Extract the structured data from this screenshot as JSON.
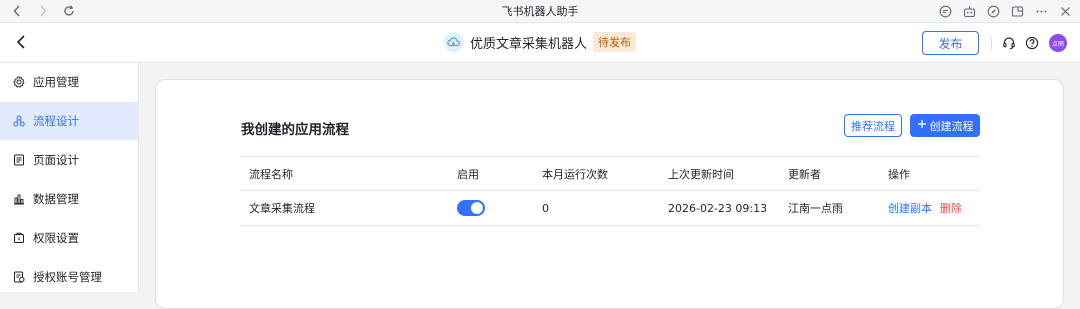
{
  "window": {
    "title": "飞书机器人助手"
  },
  "header": {
    "app_name": "优质文章采集机器人",
    "status": "待发布",
    "publish_label": "发布",
    "avatar_text": "点雨"
  },
  "sidebar": {
    "items": [
      {
        "label": "应用管理",
        "icon": "gear-icon"
      },
      {
        "label": "流程设计",
        "icon": "flow-icon",
        "active": true
      },
      {
        "label": "页面设计",
        "icon": "page-icon"
      },
      {
        "label": "数据管理",
        "icon": "chart-icon"
      },
      {
        "label": "权限设置",
        "icon": "lock-icon"
      },
      {
        "label": "授权账号管理",
        "icon": "account-icon"
      }
    ]
  },
  "main": {
    "section_title": "我创建的应用流程",
    "recommend_label": "推荐流程",
    "create_label": "创建流程",
    "columns": [
      "流程名称",
      "启用",
      "本月运行次数",
      "上次更新时间",
      "更新者",
      "操作"
    ],
    "rows": [
      {
        "name": "文章采集流程",
        "enabled": true,
        "runs": "0",
        "updated": "2026-02-23 09:13",
        "updater": "江南一点雨",
        "action_copy": "创建副本",
        "action_delete": "删除"
      }
    ]
  },
  "colors": {
    "accent": "#3370ff",
    "danger": "#f54a45",
    "badge_bg": "#fde9d6",
    "badge_text": "#c45a00"
  }
}
